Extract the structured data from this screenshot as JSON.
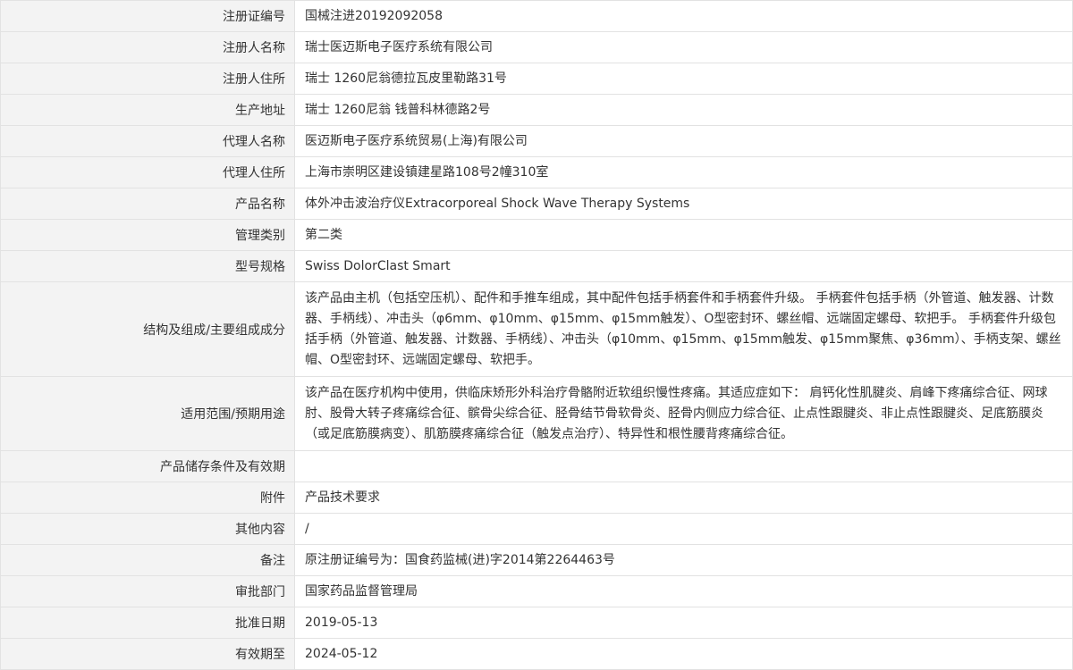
{
  "rows": [
    {
      "label": "注册证编号",
      "value": "国械注进20192092058",
      "h": 35
    },
    {
      "label": "注册人名称",
      "value": "瑞士医迈斯电子医疗系统有限公司",
      "h": 35
    },
    {
      "label": "注册人住所",
      "value": "瑞士 1260尼翁德拉瓦皮里勒路31号",
      "h": 35
    },
    {
      "label": "生产地址",
      "value": "瑞士 1260尼翁 钱普科林德路2号",
      "h": 35
    },
    {
      "label": "代理人名称",
      "value": "医迈斯电子医疗系统贸易(上海)有限公司",
      "h": 35
    },
    {
      "label": "代理人住所",
      "value": "上海市崇明区建设镇建星路108号2幢310室",
      "h": 35
    },
    {
      "label": "产品名称",
      "value": "体外冲击波治疗仪Extracorporeal Shock Wave Therapy Systems",
      "h": 35
    },
    {
      "label": "管理类别",
      "value": "第二类",
      "h": 35
    },
    {
      "label": "型号规格",
      "value": "Swiss DolorClast Smart",
      "h": 35
    },
    {
      "label": "结构及组成/主要组成成分",
      "value": "该产品由主机（包括空压机）、配件和手推车组成，其中配件包括手柄套件和手柄套件升级。 手柄套件包括手柄（外管道、触发器、计数器、手柄线）、冲击头（φ6mm、φ10mm、φ15mm、φ15mm触发）、O型密封环、螺丝帽、远端固定螺母、软把手。 手柄套件升级包括手柄（外管道、触发器、计数器、手柄线）、冲击头（φ10mm、φ15mm、φ15mm触发、φ15mm聚焦、φ36mm）、手柄支架、螺丝帽、O型密封环、远端固定螺母、软把手。",
      "h": 106
    },
    {
      "label": "适用范围/预期用途",
      "value": "该产品在医疗机构中使用，供临床矫形外科治疗骨骼附近软组织慢性疼痛。其适应症如下： 肩钙化性肌腱炎、肩峰下疼痛综合征、网球肘、股骨大转子疼痛综合征、髌骨尖综合征、胫骨结节骨软骨炎、胫骨内侧应力综合征、止点性跟腱炎、非止点性跟腱炎、足底筋膜炎（或足底筋膜病变）、肌筋膜疼痛综合征（触发点治疗）、特异性和根性腰背疼痛综合征。",
      "h": 83
    },
    {
      "label": "产品储存条件及有效期",
      "value": "",
      "h": 35
    },
    {
      "label": "附件",
      "value": "产品技术要求",
      "h": 35
    },
    {
      "label": "其他内容",
      "value": "/",
      "h": 35
    },
    {
      "label": "备注",
      "value": "原注册证编号为：国食药监械(进)字2014第2264463号",
      "h": 35
    },
    {
      "label": "审批部门",
      "value": "国家药品监督管理局",
      "h": 35
    },
    {
      "label": "批准日期",
      "value": "2019-05-13",
      "h": 35
    },
    {
      "label": "有效期至",
      "value": "2024-05-12",
      "h": 35
    }
  ]
}
